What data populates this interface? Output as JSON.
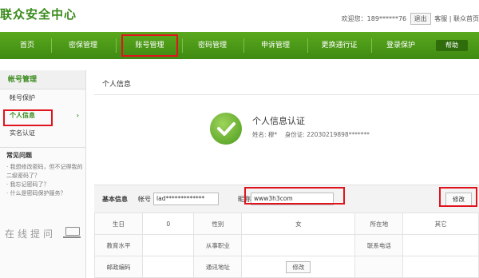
{
  "header": {
    "logo": "联众安全中心",
    "welcome": "欢迎您：189******76",
    "logout": "退出",
    "service": "客服",
    "home": "联众首页"
  },
  "nav": {
    "items": [
      "首页",
      "密保管理",
      "账号管理",
      "密码管理",
      "申诉管理",
      "更换通行证",
      "登录保护"
    ],
    "help": "帮助"
  },
  "sidebar": {
    "title": "帐号管理",
    "items": [
      {
        "label": "帐号保护"
      },
      {
        "label": "个人信息",
        "chevron": "›"
      },
      {
        "label": "实名认证"
      }
    ],
    "faq_title": "常见问题",
    "faq": [
      "· 我想修改密码，但不记得我的二级密码了？",
      "· 我忘记密码了？",
      "· 什么是密码保护服务？"
    ],
    "ask": "在线提问"
  },
  "main": {
    "title": "个人信息",
    "cert_title": "个人信息认证",
    "cert_name_label": "姓名:",
    "cert_name": "穆*",
    "cert_id_label": "身份证:",
    "cert_id": "22030219898*******"
  },
  "form": {
    "section": "基本信息",
    "account_label": "帐号",
    "account_value": "lad*************",
    "nickname_label": "昵称",
    "nickname_value": "www3h3com",
    "modify": "修改"
  },
  "table": {
    "rows": [
      [
        "生日",
        "0",
        "性别",
        "女",
        "所在地",
        "其它"
      ],
      [
        "教育水平",
        "",
        "从事职业",
        "",
        "联系电话",
        ""
      ],
      [
        "邮政编码",
        "",
        "通讯地址",
        "修改",
        "",
        ""
      ]
    ]
  },
  "colors": {
    "accent": "#3a8a1c",
    "highlight": "#e0141e"
  }
}
